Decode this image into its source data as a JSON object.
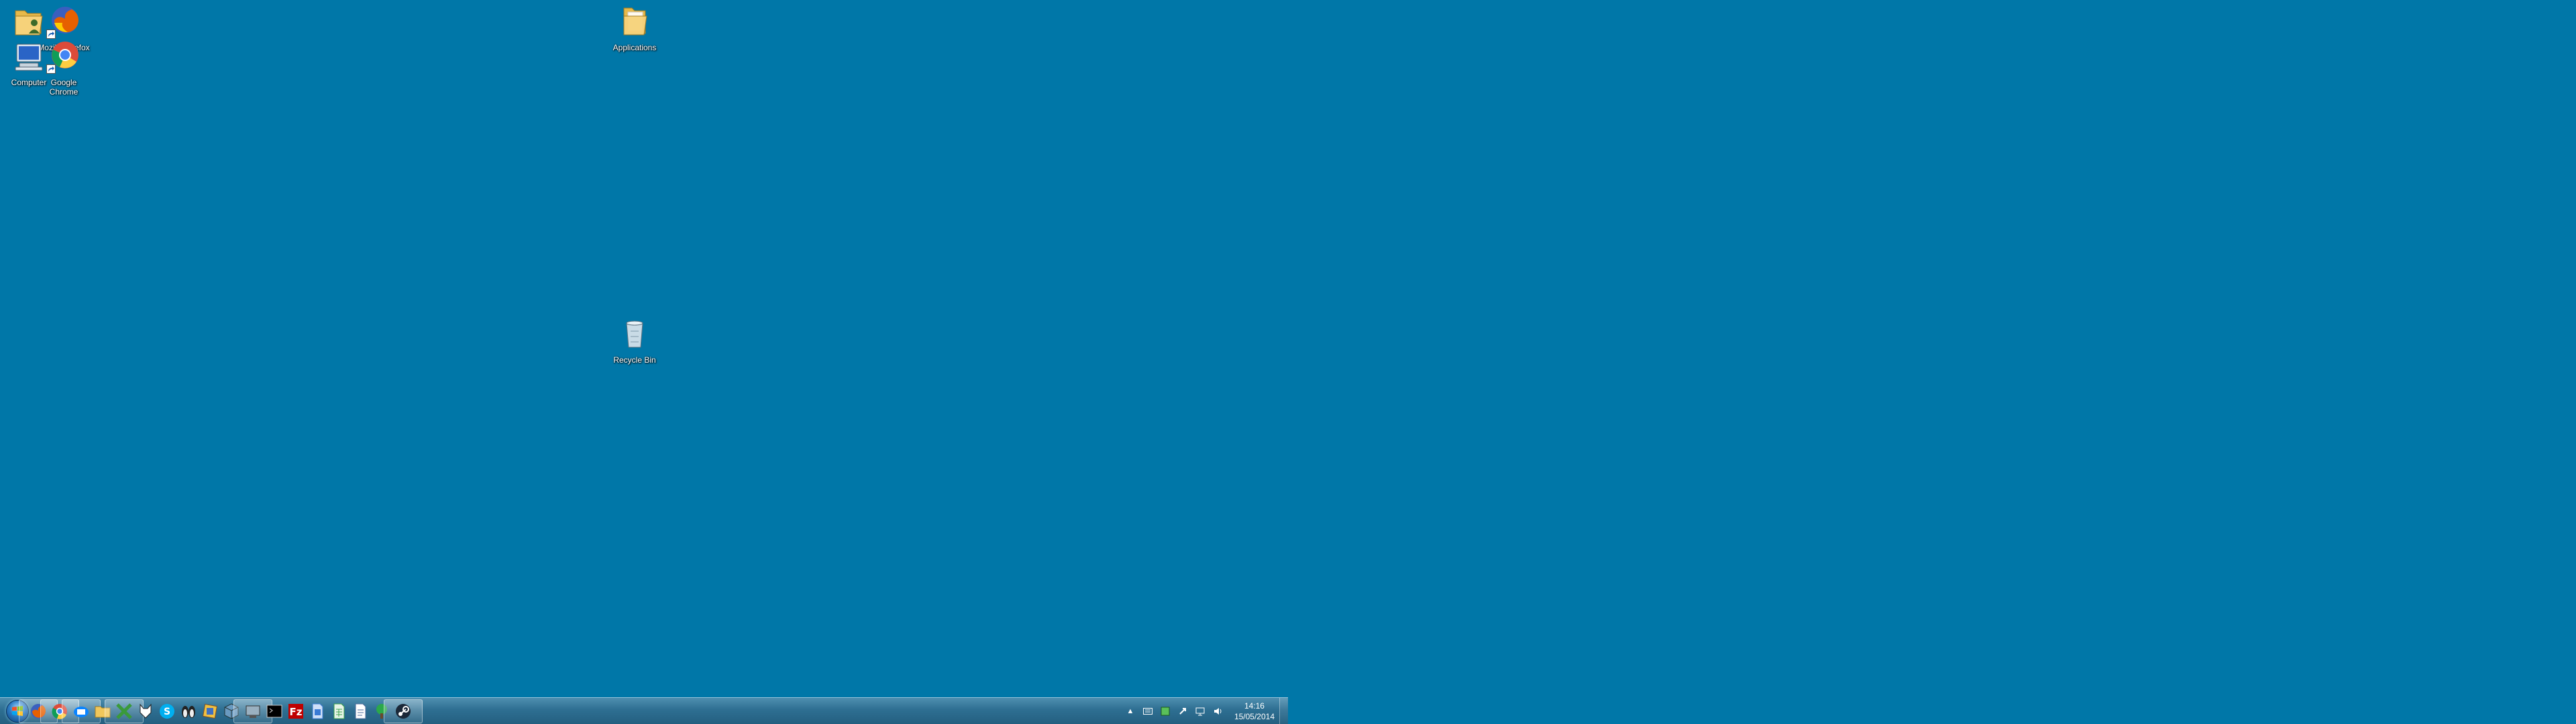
{
  "desktop": {
    "background_color": "#0077a8",
    "left_icons": [
      {
        "label": "David",
        "icon": "user-folder-icon"
      },
      {
        "label": "Mozilla Firefox",
        "icon": "firefox-icon"
      },
      {
        "label": "Computer",
        "icon": "computer-icon"
      },
      {
        "label": "Google Chrome",
        "icon": "chrome-icon"
      },
      {
        "label": "Applications",
        "icon": "folder-icon"
      },
      {
        "label": "Recycle Bin",
        "icon": "recycle-bin-icon"
      }
    ]
  },
  "taskbar": {
    "start_icon": "windows-start-orb-icon",
    "pinned": [
      {
        "icon": "firefox-icon",
        "color": "#e66000"
      },
      {
        "icon": "chrome-icon",
        "color": "#dd4b39"
      },
      {
        "icon": "thunderbird-icon",
        "color": "#0a84ff"
      },
      {
        "icon": "file-explorer-icon",
        "color": "#f1c75b"
      },
      {
        "icon": "excel-like-icon",
        "color": "#3a9a3a"
      },
      {
        "icon": "wolf-icon",
        "color": "#ffffff"
      },
      {
        "icon": "skype-icon",
        "color": "#00aff0"
      },
      {
        "icon": "penguins-icon",
        "color": "#222222"
      },
      {
        "icon": "virtualbox-icon",
        "color": "#f0c040"
      },
      {
        "icon": "cube-icon",
        "color": "#6a9ac0"
      },
      {
        "icon": "network-tool-icon",
        "color": "#9ab0c0"
      },
      {
        "icon": "terminal-icon",
        "color": "#000000"
      },
      {
        "icon": "filezilla-icon",
        "color": "#bf0000"
      },
      {
        "icon": "document-blue-icon",
        "color": "#3a7bd5"
      },
      {
        "icon": "spreadsheet-green-icon",
        "color": "#3aa04a"
      },
      {
        "icon": "document-white-icon",
        "color": "#ffffff"
      },
      {
        "icon": "tree-icon",
        "color": "#2ba84a"
      },
      {
        "icon": "steam-icon",
        "color": "#1b2838"
      }
    ],
    "tray": {
      "icons": [
        "show-hidden-icons-icon",
        "keyboard-icon",
        "green-app-icon",
        "link-icon",
        "network-icon",
        "volume-icon"
      ],
      "clock_time": "14:16",
      "clock_date": "15/05/2014"
    }
  }
}
